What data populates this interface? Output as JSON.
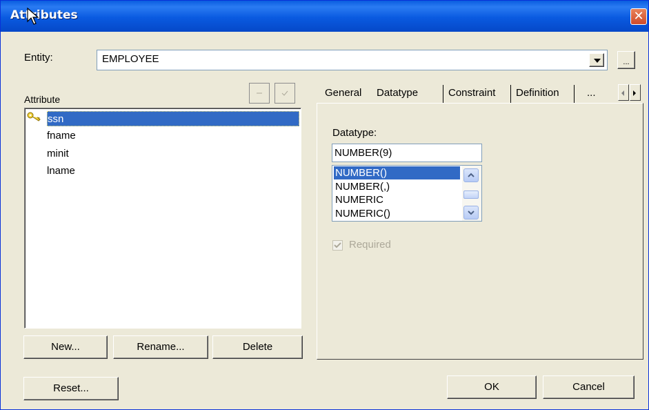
{
  "window": {
    "title": "Attributes",
    "close_glyph": "✕"
  },
  "entity": {
    "label": "Entity:",
    "value": "EMPLOYEE",
    "dropdown_icon": "chevron-down-icon",
    "more_label": "..."
  },
  "attributes": {
    "header": "Attribute",
    "items": [
      {
        "name": "ssn",
        "is_key": true,
        "selected": true
      },
      {
        "name": "fname"
      },
      {
        "name": "minit"
      },
      {
        "name": "lname"
      }
    ],
    "buttons": {
      "new": "New...",
      "rename": "Rename...",
      "delete": "Delete"
    }
  },
  "tabs": {
    "items": [
      "General",
      "Datatype",
      "Constraint",
      "Definition",
      "..."
    ],
    "active": "Datatype"
  },
  "datatype": {
    "label": "Datatype:",
    "value": "NUMBER(9)",
    "options": [
      "NUMBER()",
      "NUMBER(,)",
      "NUMERIC",
      "NUMERIC()"
    ],
    "selected": "NUMBER()"
  },
  "required": {
    "label": "Required",
    "checked": true,
    "disabled": true
  },
  "footer": {
    "reset": "Reset...",
    "ok": "OK",
    "cancel": "Cancel"
  }
}
